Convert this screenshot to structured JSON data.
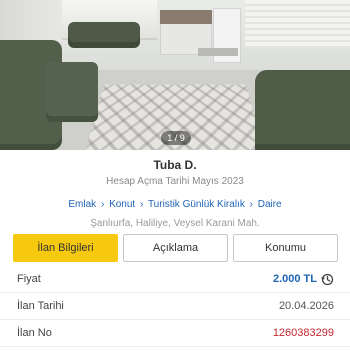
{
  "gallery": {
    "counter": "1 / 9"
  },
  "owner": {
    "name": "Tuba D.",
    "since": "Hesap Açma Tarihi  Mayıs 2023"
  },
  "breadcrumb": {
    "items": [
      "Emlak",
      "Konut",
      "Turistik Günlük Kiralık",
      "Daire"
    ],
    "separator": "›"
  },
  "location": "Şanlıurfa, Haliliye, Veysel Karani Mah.",
  "tabs": [
    {
      "label": "İlan Bilgileri",
      "active": true
    },
    {
      "label": "Açıklama",
      "active": false
    },
    {
      "label": "Konumu",
      "active": false
    }
  ],
  "details": {
    "price_label": "Fiyat",
    "price_value": "2.000 TL",
    "date_label": "İlan Tarihi",
    "date_value": "20.04.2026",
    "no_label": "İlan No",
    "no_value": "1260383299"
  },
  "colors": {
    "accent_yellow": "#f6c90e",
    "link_blue": "#1f64b5",
    "id_red": "#c4262e"
  },
  "icons": {
    "price_history": "price-history-icon"
  }
}
